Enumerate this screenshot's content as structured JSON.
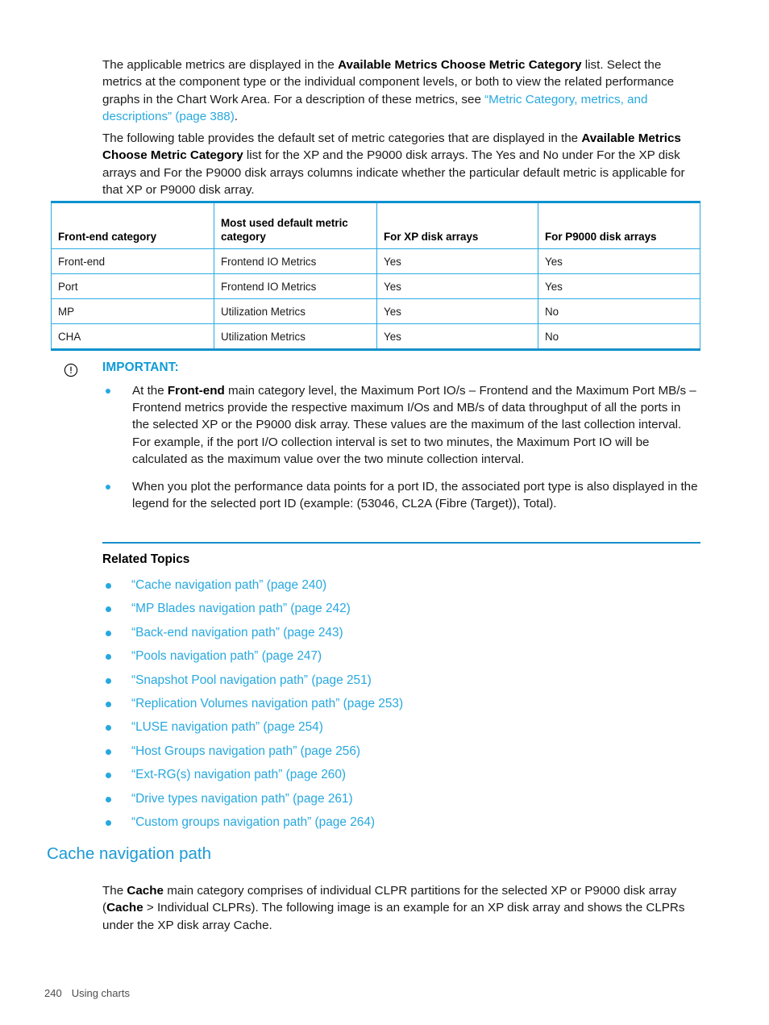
{
  "document": {
    "paragraphs": {
      "p1_part1": "The applicable metrics are displayed in the ",
      "p1_bold1": "Available Metrics Choose Metric Category",
      "p1_part2": " list. Select the metrics at the component type or the individual component levels, or both to view the related performance graphs in the Chart Work Area. For a description of these metrics, see ",
      "p1_link": "“Metric Category, metrics, and descriptions” (page 388)",
      "p1_part3": ".",
      "p2_part1": "The following table provides the default set of metric categories that are displayed in the ",
      "p2_bold1": "Available Metrics Choose Metric Category",
      "p2_part2": " list for the XP and the P9000 disk arrays. The Yes and No under For the XP disk arrays and For the P9000 disk arrays columns indicate whether the particular default metric is applicable for that XP or P9000 disk array.",
      "p3_part1": "The ",
      "p3_bold1": "Cache",
      "p3_part2": " main category comprises of individual CLPR partitions for the selected XP or P9000 disk array (",
      "p3_bold2": "Cache",
      "p3_part3": " > Individual CLPRs). The following image is an example for an XP disk array and shows the CLPRs under the XP disk array Cache."
    },
    "table": {
      "headers": [
        "Front-end category",
        "Most used default metric category",
        "For XP disk arrays",
        "For P9000 disk arrays"
      ],
      "rows": [
        [
          "Front-end",
          "Frontend IO Metrics",
          "Yes",
          "Yes"
        ],
        [
          "Port",
          "Frontend IO Metrics",
          "Yes",
          "Yes"
        ],
        [
          "MP",
          "Utilization Metrics",
          "Yes",
          "No"
        ],
        [
          "CHA",
          "Utilization Metrics",
          "Yes",
          "No"
        ]
      ]
    },
    "note": {
      "icon": "important-circle-exclamation-icon",
      "title": "IMPORTANT:",
      "bullets": [
        {
          "part1": "At the ",
          "bold1": "Front-end",
          "part2": " main category level, the Maximum Port IO/s – Frontend and the Maximum Port MB/s – Frontend metrics provide the respective maximum I/Os and MB/s of data throughput of all the ports in the selected XP or the P9000 disk array. These values are the maximum of the last collection interval. For example, if the port I/O collection interval is set to two minutes, the Maximum Port IO will be calculated as the maximum value over the two minute collection interval."
        },
        {
          "part1": "When you plot the performance data points for a port ID, the associated port type is also displayed in the legend for the selected port ID (example: (53046, CL2A (Fibre (Target)), Total).",
          "bold1": "",
          "part2": ""
        }
      ]
    },
    "related_topics": {
      "title": "Related Topics",
      "links": [
        "“Cache navigation path” (page 240)",
        "“MP Blades navigation path” (page 242)",
        "“Back-end navigation path” (page 243)",
        "“Pools navigation path” (page 247)",
        "“Snapshot Pool navigation path” (page 251)",
        "“Replication Volumes navigation path” (page 253)",
        "“LUSE navigation path” (page 254)",
        "“Host Groups navigation path” (page 256)",
        "“Ext-RG(s) navigation path” (page 260)",
        "“Drive types navigation path” (page 261)",
        "“Custom groups navigation path” (page 264)"
      ]
    },
    "section": {
      "heading": "Cache navigation path"
    },
    "footer": {
      "page_number": "240",
      "chapter": "Using charts"
    },
    "colors": {
      "link": "#27a8df",
      "heading": "#1b9ad6",
      "table_border": "#29abe2",
      "note_rule": "#1a8fc9",
      "important_label": "#0f9bd7"
    }
  }
}
